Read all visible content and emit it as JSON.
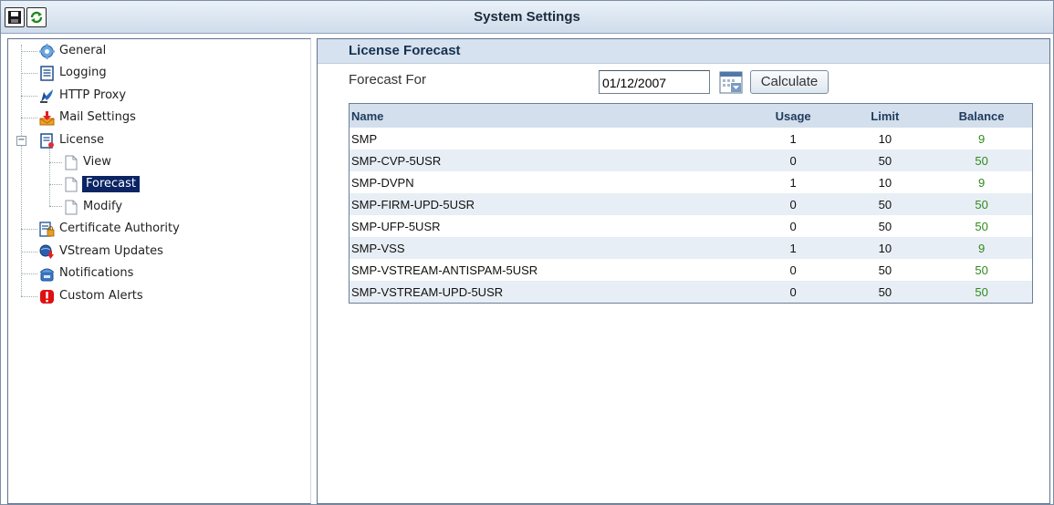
{
  "window": {
    "title": "System Settings"
  },
  "toolbar": {
    "save_icon": "save-icon",
    "refresh_icon": "refresh-icon"
  },
  "tree": {
    "items": [
      {
        "label": "General",
        "icon": "gear-icon"
      },
      {
        "label": "Logging",
        "icon": "document-icon"
      },
      {
        "label": "HTTP Proxy",
        "icon": "satellite-dish-icon"
      },
      {
        "label": "Mail Settings",
        "icon": "mail-download-icon"
      },
      {
        "label": "License",
        "icon": "license-document-icon",
        "expanded": true,
        "children": [
          {
            "label": "View",
            "icon": "page-icon"
          },
          {
            "label": "Forecast",
            "icon": "page-icon",
            "selected": true
          },
          {
            "label": "Modify",
            "icon": "page-icon"
          }
        ]
      },
      {
        "label": "Certificate Authority",
        "icon": "certificate-lock-icon"
      },
      {
        "label": "VStream Updates",
        "icon": "globe-download-icon"
      },
      {
        "label": "Notifications",
        "icon": "phone-icon"
      },
      {
        "label": "Custom Alerts",
        "icon": "alert-icon"
      }
    ]
  },
  "panel": {
    "title": "License Forecast",
    "forecast_label": "Forecast For",
    "date_value": "01/12/2007",
    "calculate_label": "Calculate",
    "columns": [
      "Name",
      "Usage",
      "Limit",
      "Balance"
    ],
    "rows": [
      [
        "SMP",
        "1",
        "10",
        "9"
      ],
      [
        "SMP-CVP-5USR",
        "0",
        "50",
        "50"
      ],
      [
        "SMP-DVPN",
        "1",
        "10",
        "9"
      ],
      [
        "SMP-FIRM-UPD-5USR",
        "0",
        "50",
        "50"
      ],
      [
        "SMP-UFP-5USR",
        "0",
        "50",
        "50"
      ],
      [
        "SMP-VSS",
        "1",
        "10",
        "9"
      ],
      [
        "SMP-VSTREAM-ANTISPAM-5USR",
        "0",
        "50",
        "50"
      ],
      [
        "SMP-VSTREAM-UPD-5USR",
        "0",
        "50",
        "50"
      ]
    ]
  },
  "colors": {
    "selection": "#0a2464",
    "balance_green": "#2e8b1a",
    "header_bg": "#d3dfec"
  }
}
